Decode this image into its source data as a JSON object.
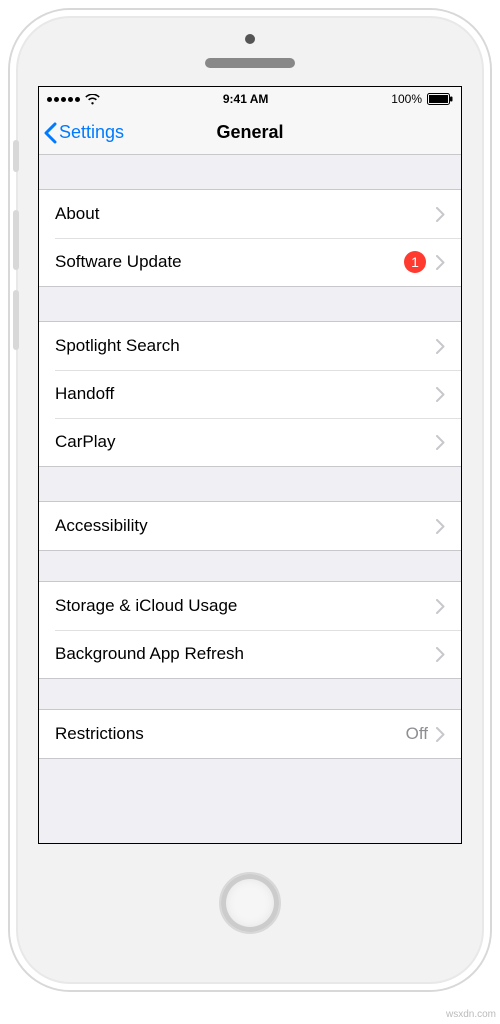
{
  "status_bar": {
    "carrier_dots": 5,
    "time": "9:41 AM",
    "battery_pct": "100%"
  },
  "nav": {
    "back_label": "Settings",
    "title": "General"
  },
  "groups": {
    "g1": {
      "about": "About",
      "software_update": "Software Update",
      "software_update_badge": "1"
    },
    "g2": {
      "spotlight": "Spotlight Search",
      "handoff": "Handoff",
      "carplay": "CarPlay"
    },
    "g3": {
      "accessibility": "Accessibility"
    },
    "g4": {
      "storage": "Storage & iCloud Usage",
      "background_refresh": "Background App Refresh"
    },
    "g5": {
      "restrictions": "Restrictions",
      "restrictions_value": "Off"
    }
  },
  "watermark": "wsxdn.com"
}
